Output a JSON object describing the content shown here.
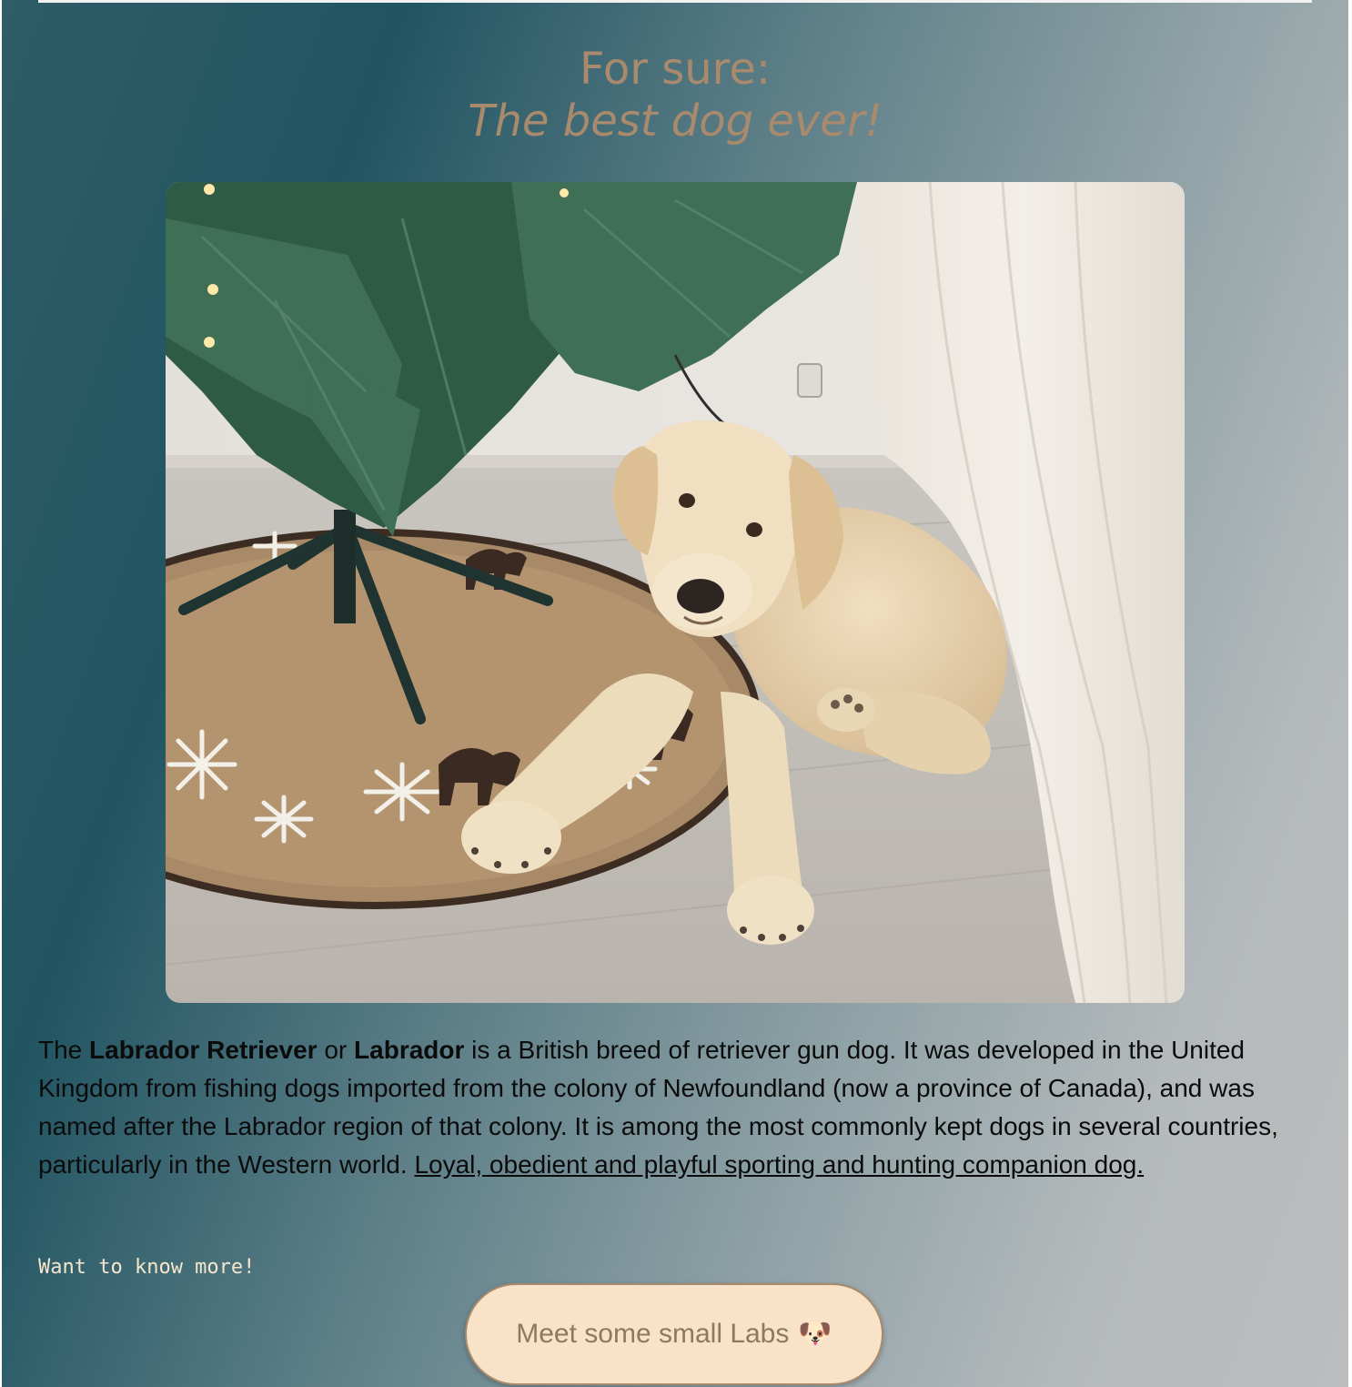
{
  "headline": {
    "line1": "For sure:",
    "line2": "The best dog ever!"
  },
  "photo": {
    "subject": "yellow Labrador puppy lying on a tree skirt under a Christmas tree"
  },
  "description": {
    "intro": "The ",
    "name1": "Labrador Retriever",
    "joiner": " or ",
    "name2": "Labrador",
    "body": " is a British breed of retriever gun dog. It was developed in the United Kingdom from fishing dogs imported from the colony of Newfoundland (now a province of Canada), and was named after the Labrador region of that colony. It is among the most commonly kept dogs in several countries, particularly in the Western world. ",
    "link": "Loyal, obedient and playful sporting and hunting companion dog."
  },
  "more_label": "Want to know more!",
  "cta": {
    "label": "Meet some small Labs",
    "emoji": "🐶"
  },
  "colors": {
    "headline": "#a98a6d",
    "cta_background": "#f8e3c8",
    "cta_text": "#8f7762",
    "more_text": "#f6e6cc"
  }
}
